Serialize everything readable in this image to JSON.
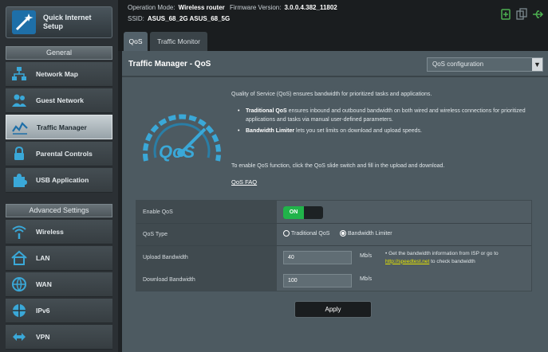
{
  "sidebar": {
    "quick_setup": "Quick Internet\nSetup",
    "general_header": "General",
    "general_items": [
      {
        "label": "Network Map",
        "icon": "network-map-icon"
      },
      {
        "label": "Guest Network",
        "icon": "guest-network-icon"
      },
      {
        "label": "Traffic Manager",
        "icon": "traffic-manager-icon",
        "active": true
      },
      {
        "label": "Parental Controls",
        "icon": "parental-controls-icon"
      },
      {
        "label": "USB Application",
        "icon": "usb-application-icon"
      }
    ],
    "advanced_header": "Advanced Settings",
    "advanced_items": [
      {
        "label": "Wireless",
        "icon": "wireless-icon"
      },
      {
        "label": "LAN",
        "icon": "lan-icon"
      },
      {
        "label": "WAN",
        "icon": "wan-icon"
      },
      {
        "label": "IPv6",
        "icon": "ipv6-icon"
      },
      {
        "label": "VPN",
        "icon": "vpn-icon"
      }
    ]
  },
  "topbar": {
    "op_mode_label": "Operation Mode:",
    "op_mode_value": "Wireless router",
    "firmware_label": "Firmware Version:",
    "firmware_value": "3.0.0.4.382_11802",
    "ssid_label": "SSID:",
    "ssid_values": "ASUS_68_2G  ASUS_68_5G"
  },
  "tabs": [
    {
      "label": "QoS",
      "active": true
    },
    {
      "label": "Traffic Monitor",
      "active": false
    }
  ],
  "panel": {
    "title": "Traffic Manager - QoS",
    "config_select": "QoS configuration"
  },
  "description": {
    "intro": "Quality of Service (QoS) ensures bandwidth for prioritized tasks and applications.",
    "bullets": [
      {
        "bold": "Traditional QoS",
        "text": " ensures inbound and outbound bandwidth on both wired and wireless connections for prioritized applications and tasks via manual user-defined parameters."
      },
      {
        "bold": "Bandwidth Limiter",
        "text": " lets you set limits on download and upload speeds."
      }
    ],
    "enable_hint": "To enable QoS function, click the QoS slide switch and fill in the upload and download.",
    "faq_link": "QoS FAQ"
  },
  "settings": {
    "enable_label": "Enable QoS",
    "toggle_on": "ON",
    "type_label": "QoS Type",
    "type_options": [
      "Traditional QoS",
      "Bandwidth Limiter"
    ],
    "type_selected": 1,
    "upload_label": "Upload Bandwidth",
    "upload_value": "40",
    "download_label": "Download Bandwidth",
    "download_value": "100",
    "unit": "Mb/s",
    "note_prefix": "Get the bandwidth information from ISP or go to ",
    "note_link": "http://speedtest.net",
    "note_suffix": " to check bandwidth"
  },
  "apply_label": "Apply",
  "colors": {
    "toggle_on": "#21b34a",
    "accent_blue": "#3aa8d8",
    "link_yellow": "#e6e600"
  }
}
